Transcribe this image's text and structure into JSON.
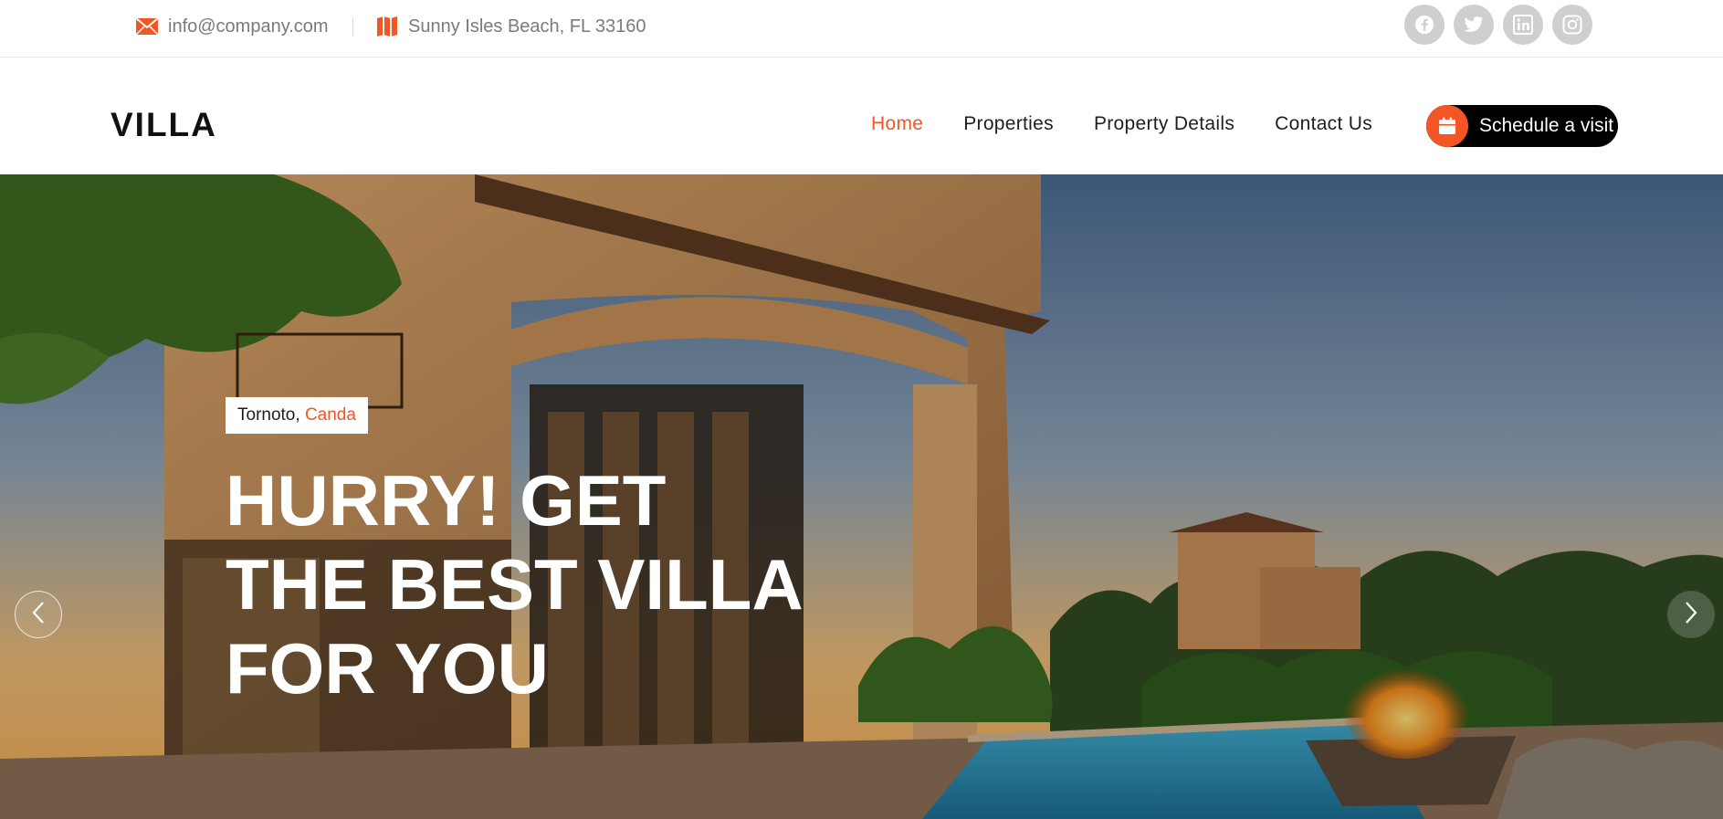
{
  "topbar": {
    "email": "info@company.com",
    "address": "Sunny Isles Beach, FL 33160",
    "socials": [
      {
        "icon": "facebook-icon"
      },
      {
        "icon": "twitter-icon"
      },
      {
        "icon": "linkedin-icon"
      },
      {
        "icon": "instagram-icon"
      }
    ]
  },
  "header": {
    "logo": "VILLA",
    "nav": [
      {
        "label": "Home",
        "active": true
      },
      {
        "label": "Properties",
        "active": false
      },
      {
        "label": "Property Details",
        "active": false
      },
      {
        "label": "Contact Us",
        "active": false
      }
    ],
    "cta_label": "Schedule a visit",
    "cta_icon": "calendar-icon"
  },
  "hero": {
    "location_city": "Tornoto,",
    "location_country": "Canda",
    "headline": "HURRY! GET THE BEST VILLA FOR YOU",
    "prev_icon": "chevron-left-icon",
    "next_icon": "chevron-right-icon"
  },
  "colors": {
    "accent": "#f35525",
    "dark": "#000000",
    "social_bg": "#cfcfcf"
  }
}
